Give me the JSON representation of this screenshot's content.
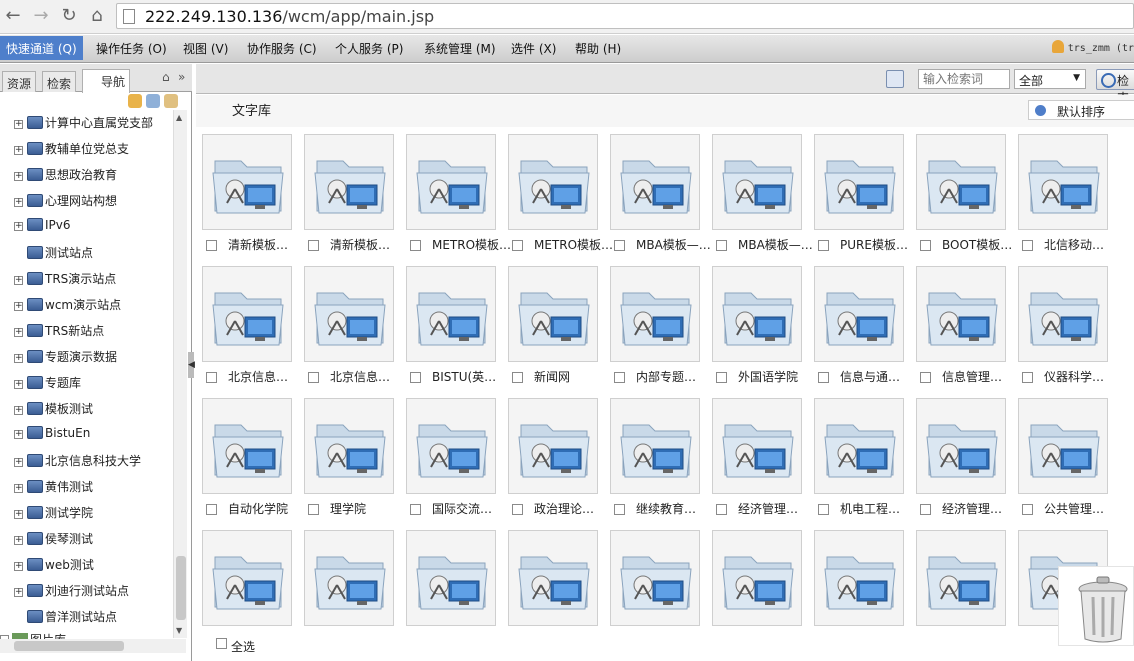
{
  "browser": {
    "url_host": "222.249.130.136",
    "url_path": "/wcm/app/main.jsp"
  },
  "menu": {
    "items": [
      "快速通道 (Q)",
      "操作任务 (O)",
      "视图 (V)",
      "协作服务 (C)",
      "个人服务 (P)",
      "系统管理 (M)",
      "选件 (X)",
      "帮助 (H)"
    ],
    "user": "trs_zmm (tr"
  },
  "left": {
    "tabs": [
      "资源",
      "检索",
      "导航"
    ],
    "tree": [
      {
        "label": "计算中心直属党支部",
        "expandable": true
      },
      {
        "label": "教辅单位党总支",
        "expandable": true
      },
      {
        "label": "思想政治教育",
        "expandable": true
      },
      {
        "label": "心理网站构想",
        "expandable": true
      },
      {
        "label": "IPv6",
        "expandable": true
      },
      {
        "label": "测试站点",
        "expandable": false
      },
      {
        "label": "TRS演示站点",
        "expandable": true
      },
      {
        "label": "wcm演示站点",
        "expandable": true
      },
      {
        "label": "TRS新站点",
        "expandable": true
      },
      {
        "label": "专题演示数据",
        "expandable": true
      },
      {
        "label": "专题库",
        "expandable": true
      },
      {
        "label": "模板测试",
        "expandable": true
      },
      {
        "label": "BistuEn",
        "expandable": true
      },
      {
        "label": "北京信息科技大学",
        "expandable": true
      },
      {
        "label": "黄伟测试",
        "expandable": true
      },
      {
        "label": "测试学院",
        "expandable": true
      },
      {
        "label": "侯琴测试",
        "expandable": true
      },
      {
        "label": "web测试",
        "expandable": true
      },
      {
        "label": "刘迪行测试站点",
        "expandable": true
      },
      {
        "label": "曾洋测试站点",
        "expandable": false
      }
    ],
    "bottom_node": "图片库"
  },
  "search": {
    "placeholder": "输入检索词",
    "scope": "全部",
    "button": "检索"
  },
  "main": {
    "title": "文字库",
    "sort": "默认排序",
    "select_all": "全选",
    "rows": [
      [
        "清新模板…",
        "清新模板…",
        "METRO模板…",
        "METRO模板…",
        "MBA模板—…",
        "MBA模板—…",
        "PURE模板…",
        "BOOT模板…",
        "北信移动…"
      ],
      [
        "北京信息…",
        "北京信息…",
        "BISTU(英…",
        "新闻网",
        "内部专题…",
        "外国语学院",
        "信息与通…",
        "信息管理…",
        "仪器科学…"
      ],
      [
        "自动化学院",
        "理学院",
        "国际交流…",
        "政治理论…",
        "继续教育…",
        "经济管理…",
        "机电工程…",
        "经济管理…",
        "公共管理…"
      ],
      [
        "",
        "",
        "",
        "",
        "",
        "",
        "",
        "",
        ""
      ]
    ]
  }
}
